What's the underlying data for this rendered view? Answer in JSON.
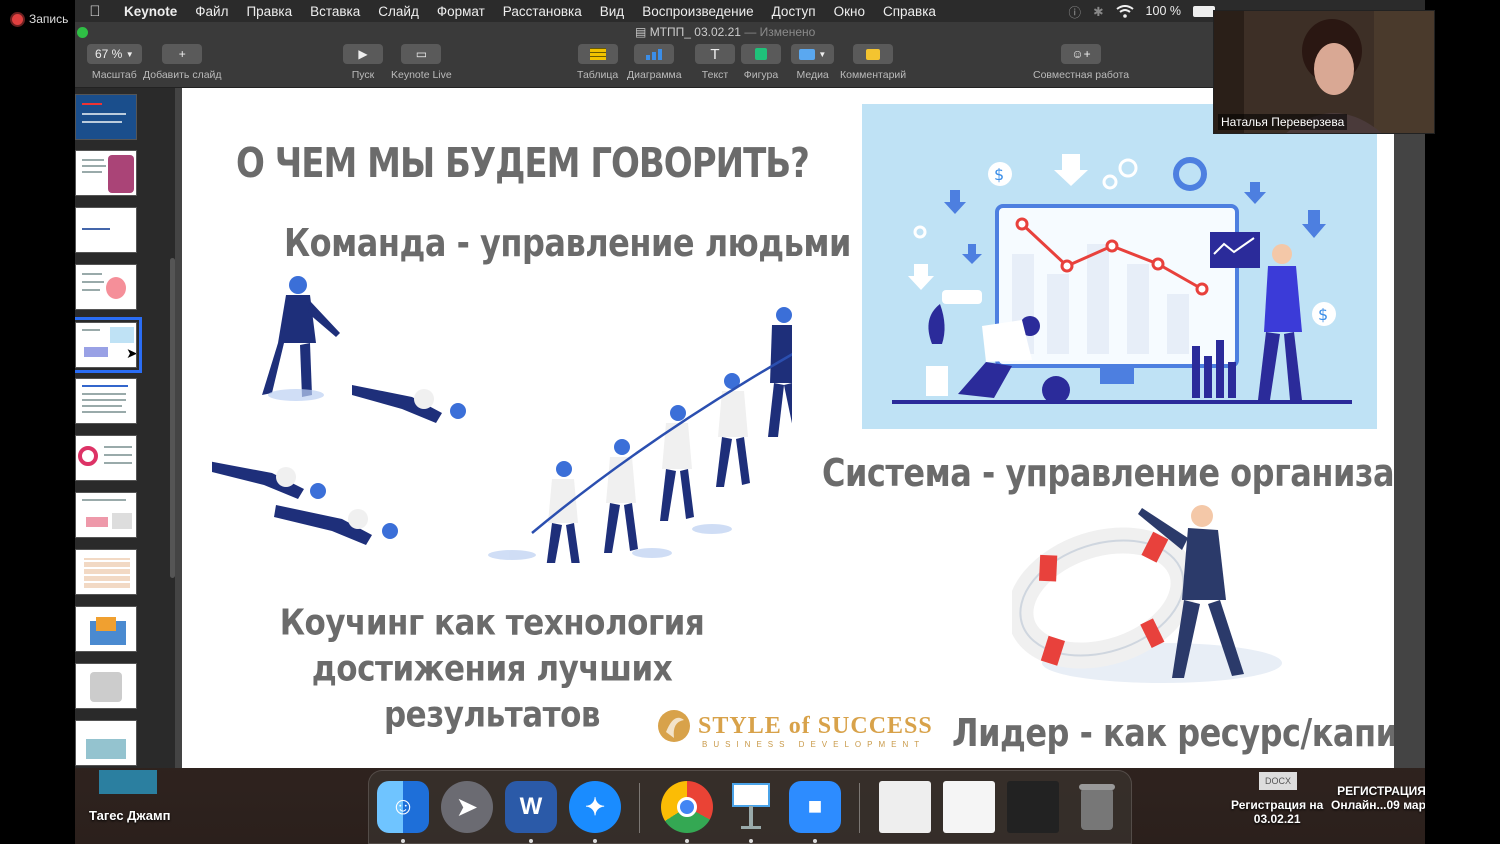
{
  "recording": {
    "label": "Запись"
  },
  "menubar": {
    "app": "Keynote",
    "items": [
      "Файл",
      "Правка",
      "Вставка",
      "Слайд",
      "Формат",
      "Расстановка",
      "Вид",
      "Воспроизведение",
      "Доступ",
      "Окно",
      "Справка"
    ],
    "battery": "100 %"
  },
  "document": {
    "title": "МТПП_ 03.02.21",
    "status": "— Изменено"
  },
  "toolbar": {
    "zoom_value": "67 %",
    "zoom_label": "Масштаб",
    "add_slide_label": "Добавить слайд",
    "play_label": "Пуск",
    "keynote_live_label": "Keynote Live",
    "table_label": "Таблица",
    "chart_label": "Диаграмма",
    "text_label": "Текст",
    "shape_label": "Фигура",
    "media_label": "Медиа",
    "comment_label": "Комментарий",
    "collaborate_label": "Совместная работа"
  },
  "slide": {
    "title": "О ЧЕМ МЫ БУДЕМ ГОВОРИТЬ?",
    "team": "Команда - управление людьми",
    "system": "Система - управление организацией",
    "coaching_line1": "Коучинг как технология",
    "coaching_line2": "достижения лучших результатов",
    "leader": "Лидер - как ресурс/капитал",
    "logo_main": "STYLE of SUCCESS",
    "logo_sub": "BUSINESS DEVELOPMENT"
  },
  "camera": {
    "name": "Наталья Переверзева"
  },
  "desktop": {
    "left_item": "Тагес Джамп",
    "file1_line1": "Регистрация на",
    "file1_line2": "03.02.21",
    "file2_line1": "РЕГИСТРАЦИЯ",
    "file2_line2": "Онлайн...09 мар",
    "docx": "DOCX"
  },
  "colors": {
    "selection": "#2a6df5",
    "slide_text": "#6b6b6b",
    "illustration_bg": "#bfe2f5",
    "accent_red": "#e8413c",
    "accent_blue": "#2b2b9a"
  }
}
